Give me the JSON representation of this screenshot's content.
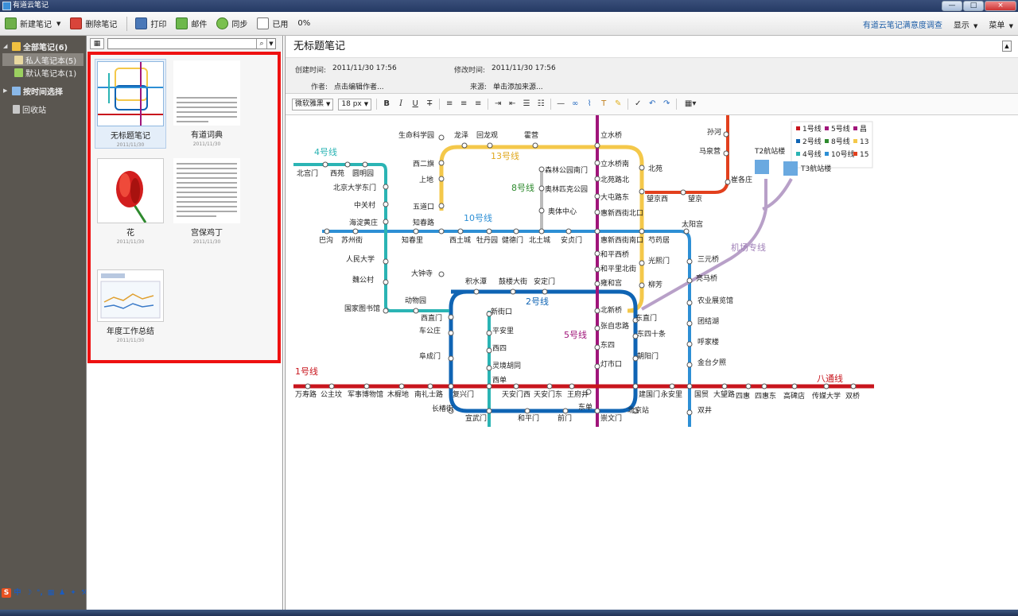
{
  "window": {
    "title": "有道云笔记",
    "controls": [
      "—",
      "□",
      "×"
    ]
  },
  "toolbar": {
    "new_note": "新建笔记",
    "delete_note": "删除笔记",
    "print": "打印",
    "mail": "邮件",
    "sync": "同步",
    "used_label": "已用",
    "used_value": "0%",
    "survey": "有道云笔记满意度调查",
    "display": "显示",
    "menu": "菜单"
  },
  "sidebar": {
    "all_notes": "全部笔记(6)",
    "private_notebook": "私人笔记本(5)",
    "default_notebook": "默认笔记本(1)",
    "by_time": "按时间选择",
    "trash": "回收站"
  },
  "search": {
    "placeholder": ""
  },
  "notes": [
    {
      "title": "无标题笔记",
      "date": "2011/11/30"
    },
    {
      "title": "有道词典",
      "date": "2011/11/30"
    },
    {
      "title": "花",
      "date": "2011/11/30"
    },
    {
      "title": "宫保鸡丁",
      "date": "2011/11/30"
    },
    {
      "title": "年度工作总结",
      "date": "2011/11/30"
    }
  ],
  "editor": {
    "title": "无标题笔记",
    "created_label": "创建时间:",
    "created_value": "2011/11/30 17:56",
    "modified_label": "修改时间:",
    "modified_value": "2011/11/30 17:56",
    "author_label": "作者:",
    "author_value": "点击编辑作者...",
    "source_label": "来源:",
    "source_value": "单击添加来源...",
    "font_name": "微软雅黑",
    "font_size": "18 px"
  },
  "metro_map": {
    "line_labels": {
      "line1": "1号线",
      "line2": "2号线",
      "line4": "4号线",
      "line5": "5号线",
      "line8": "8号线",
      "line10": "10号线",
      "line13": "13号线",
      "batong": "八通线",
      "airport": "机场专线"
    },
    "legend": [
      "1号线",
      "5号线",
      "昌",
      "2号线",
      "8号线",
      "13",
      "4号线",
      "10号线",
      "15"
    ],
    "terminals": {
      "t2": "T2航站楼",
      "t3": "T3航站楼"
    },
    "colors": {
      "line1": "#c8151d",
      "line2": "#0f64b4",
      "line4": "#2bb4b4",
      "line5": "#a0157a",
      "line8": "#bbbbbb",
      "line10": "#2d8fd5",
      "line13": "#f4c84a",
      "line15": "#e2401d",
      "airport": "#b8a0c8"
    },
    "stations": {
      "s01": "东单",
      "s02": "生命科学园",
      "s03": "龙泽",
      "s04": "回龙观",
      "s05": "霍营",
      "s06": "立水桥",
      "s07": "孙河",
      "s08": "马泉营",
      "s09": "崔各庄",
      "s10": "北宫门",
      "s11": "西苑",
      "s12": "圆明园",
      "s13": "北京大学东门",
      "s14": "中关村",
      "s15": "海淀黄庄",
      "s16": "西二旗",
      "s17": "上地",
      "s18": "五道口",
      "s19": "知春路",
      "s20": "森林公园南门",
      "s21": "奥林匹克公园",
      "s22": "奥体中心",
      "s23": "立水桥南",
      "s24": "北苑路北",
      "s25": "大屯路东",
      "s26": "惠新西街北口",
      "s27": "北苑",
      "s28": "望京西",
      "s29": "望京",
      "s30": "巴沟",
      "s31": "苏州街",
      "s32": "知春里",
      "s33": "西土城",
      "s34": "牡丹园",
      "s35": "健德门",
      "s36": "北土城",
      "s37": "安贞门",
      "s38": "惠新西街南口",
      "s39": "芍药居",
      "s40": "太阳宫",
      "s41": "人民大学",
      "s42": "和平西桥",
      "s43": "光熙门",
      "s44": "三元桥",
      "s45": "魏公村",
      "s46": "大钟寺",
      "s47": "和平里北街",
      "s48": "积水潭",
      "s49": "鼓楼大街",
      "s50": "安定门",
      "s51": "雍和宫",
      "s52": "柳芳",
      "s53": "亮马桥",
      "s54": "国家图书馆",
      "s55": "动物园",
      "s56": "西直门",
      "s57": "新街口",
      "s58": "北新桥",
      "s59": "东直门",
      "s60": "农业展览馆",
      "s61": "车公庄",
      "s62": "平安里",
      "s63": "张自忠路",
      "s64": "东四十条",
      "s65": "团结湖",
      "s66": "西四",
      "s67": "东四",
      "s68": "呼家楼",
      "s69": "阜成门",
      "s70": "朝阳门",
      "s71": "灵境胡同",
      "s72": "灯市口",
      "s73": "金台夕照",
      "s74": "西单",
      "s75": "万寿路",
      "s76": "公主坟",
      "s77": "军事博物馆",
      "s78": "木樨地",
      "s79": "南礼士路",
      "s80": "复兴门",
      "s81": "天安门西",
      "s82": "天安门东",
      "s83": "王府井",
      "s84": "建国门",
      "s85": "永安里",
      "s86": "国贸",
      "s87": "大望路",
      "s88": "四惠",
      "s89": "四惠东",
      "s90": "高碑店",
      "s91": "传媒大学",
      "s92": "双桥",
      "s93": "长椿街",
      "s94": "宣武门",
      "s95": "和平门",
      "s96": "前门",
      "s97": "崇文门",
      "s98": "北京站",
      "s99": "双井"
    }
  }
}
